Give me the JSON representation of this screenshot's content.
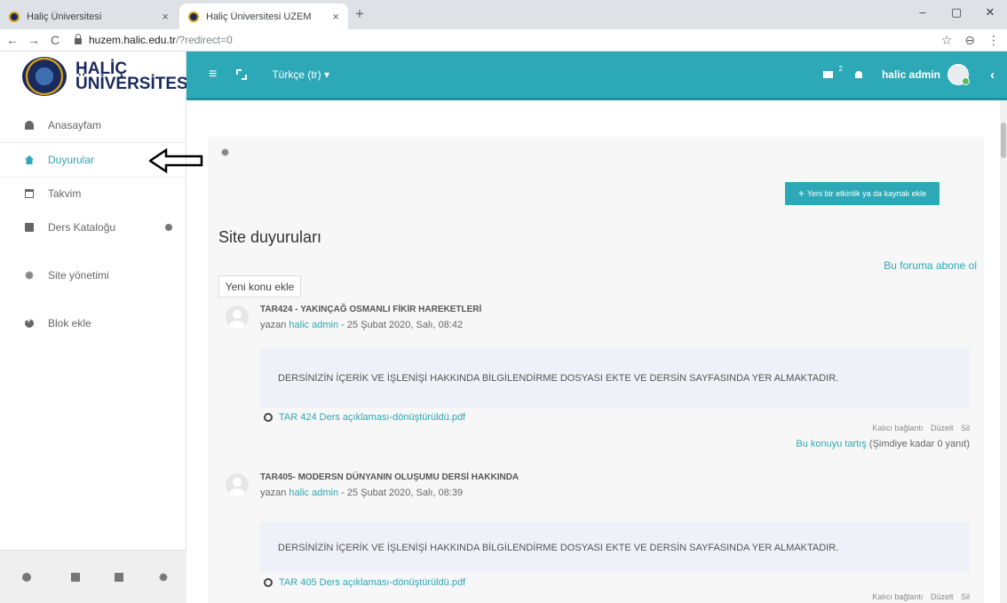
{
  "browser": {
    "tabs": [
      {
        "title": "Haliç Üniversitesi",
        "close": "×"
      },
      {
        "title": "Haliç Üniversitesi UZEM",
        "close": "×"
      }
    ],
    "new_tab": "+",
    "window_controls": {
      "minimize": "–",
      "maximize": "▢",
      "close": "✕"
    },
    "nav": {
      "back": "←",
      "forward": "→",
      "reload": "C"
    },
    "url_host": "huzem.halic.edu.tr",
    "url_path": "/?redirect=0",
    "star": "☆",
    "profile": "⊖",
    "menu": "⋮"
  },
  "logo": {
    "line1": "HALİÇ",
    "line2": "ÜNİVERSİTESİ"
  },
  "topnav": {
    "menu_icon": "≡",
    "language": "Türkçe (tr) ▾",
    "mail_badge": "2",
    "user_name": "halic admin",
    "collapse": "‹"
  },
  "sidebar": {
    "items": [
      {
        "label": "Anasayfam",
        "icon": "dashboard-icon"
      },
      {
        "label": "Duyurular",
        "icon": "home-icon",
        "active": true
      },
      {
        "label": "Takvim",
        "icon": "calendar-icon"
      },
      {
        "label": "Ders Kataloğu",
        "icon": "book-icon"
      },
      {
        "label": "Site yönetimi",
        "icon": "gear-icon"
      },
      {
        "label": "Blok ekle",
        "icon": "plus-circle-icon"
      }
    ],
    "footer_icons": [
      "chat-icon",
      "file-icon",
      "book-icon",
      "gear-icon"
    ]
  },
  "main": {
    "add_activity": "Yeni bir etkinlik ya da kaynak ekle",
    "title": "Site duyuruları",
    "subscribe": "Bu foruma abone ol",
    "new_topic": "Yeni konu ekle",
    "posts": [
      {
        "subject": "TAR424 - YAKINÇAĞ OSMANLI FİKİR HAREKETLERİ",
        "by": "yazan ",
        "author": "halic admin",
        "date": " - 25 Şubat 2020, Salı, 08:42",
        "message": "DERSİNİZİN İÇERİK VE İŞLENİŞİ HAKKINDA BİLGİLENDİRME DOSYASI EKTE VE DERSİN SAYFASINDA YER ALMAKTADIR.",
        "attachment": "TAR 424 Ders açıklaması-dönüştürüldü.pdf",
        "actions": [
          "Kalıcı bağlantı",
          "Düzelt",
          "Sil"
        ],
        "discuss_link": "Bu konuyu tartış",
        "discuss_count": " (Şimdiye kadar 0 yanıt)"
      },
      {
        "subject": "TAR405- MODERSN DÜNYANIN OLUŞUMU DERSİ HAKKINDA",
        "by": "yazan ",
        "author": "halic admin",
        "date": " - 25 Şubat 2020, Salı, 08:39",
        "message": "DERSİNİZİN İÇERİK VE İŞLENİŞİ HAKKINDA BİLGİLENDİRME DOSYASI EKTE VE DERSİN SAYFASINDA YER ALMAKTADIR.",
        "attachment": "TAR 405 Ders açıklaması-dönüştürüldü.pdf",
        "actions": [
          "Kalıcı bağlantı",
          "Düzelt",
          "Sil"
        ]
      }
    ]
  },
  "colors": {
    "accent": "#2ca8b6",
    "brand": "#1a2a5e",
    "gold": "#d4a017"
  }
}
